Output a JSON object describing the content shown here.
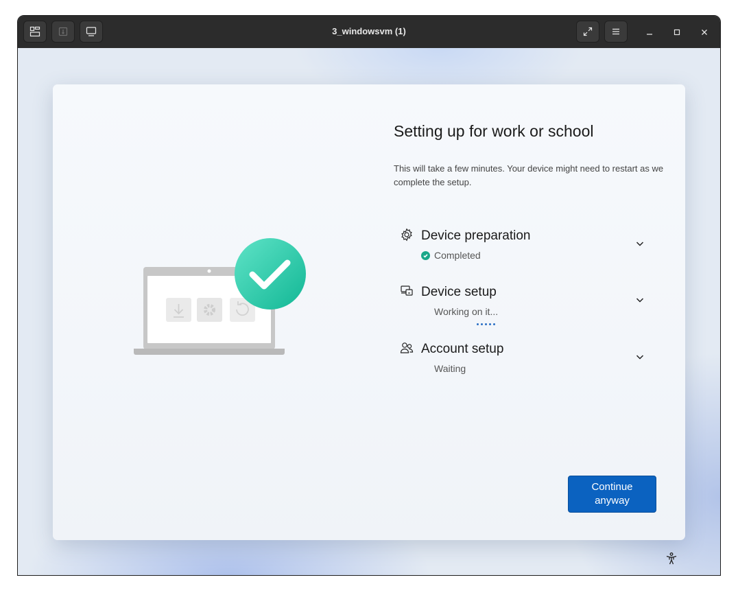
{
  "window": {
    "title": "3_windowsvm (1)"
  },
  "toolbar": {
    "left_icons": [
      "display-layout-icon",
      "usb-icon",
      "monitor-icon"
    ],
    "right_icons": [
      "fullscreen-icon",
      "menu-icon"
    ],
    "controls": [
      "minimize-icon",
      "maximize-icon",
      "close-icon"
    ]
  },
  "setup": {
    "heading": "Setting up for work or school",
    "description": "This will take a few minutes. Your device might need to restart as we complete the setup.",
    "steps": [
      {
        "title": "Device preparation",
        "status": "Completed",
        "icon": "gear-icon"
      },
      {
        "title": "Device setup",
        "status": "Working on it...",
        "icon": "device-setup-icon"
      },
      {
        "title": "Account setup",
        "status": "Waiting",
        "icon": "people-icon"
      }
    ],
    "continue_label": "Continue anyway"
  },
  "colors": {
    "accent": "#0b62c0",
    "success": "#1aa88a",
    "titlebar": "#2c2c2c"
  }
}
